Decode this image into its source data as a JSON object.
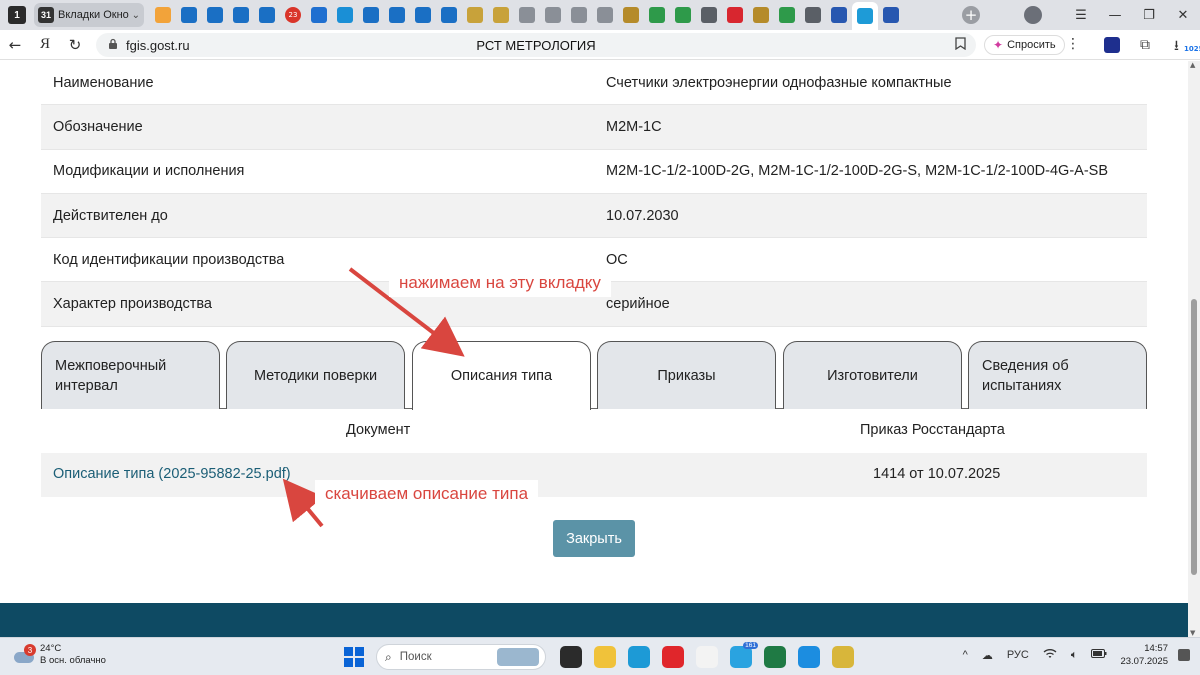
{
  "browser": {
    "tab_counter": "1",
    "group_tab": {
      "icon_text": "31",
      "label": "Вкладки Окно 1"
    },
    "pinned_tabs": [
      {
        "icon": "mail-icon",
        "color": "#f2a33a"
      },
      {
        "icon": "rst-icon",
        "color": "#1a6fc4"
      },
      {
        "icon": "rst-icon",
        "color": "#1a6fc4"
      },
      {
        "icon": "rst-icon",
        "color": "#1a6fc4"
      },
      {
        "icon": "rst-icon",
        "color": "#1a6fc4"
      },
      {
        "icon": "calendar-icon",
        "color": "#d9352a",
        "text": "23"
      },
      {
        "icon": "app-icon",
        "color": "#1f6fd0"
      },
      {
        "icon": "shield-icon",
        "color": "#1a8fd6"
      },
      {
        "icon": "rst-icon",
        "color": "#1a6fc4"
      },
      {
        "icon": "rst-icon",
        "color": "#1a6fc4"
      },
      {
        "icon": "rst-icon",
        "color": "#1a6fc4"
      },
      {
        "icon": "rst-icon",
        "color": "#1a6fc4"
      },
      {
        "icon": "emblem-icon",
        "color": "#c8a23a"
      },
      {
        "icon": "emblem-icon",
        "color": "#c8a23a"
      },
      {
        "icon": "document-icon",
        "color": "#8a8f97"
      },
      {
        "icon": "document-icon",
        "color": "#8a8f97"
      },
      {
        "icon": "document-icon",
        "color": "#8a8f97"
      },
      {
        "icon": "document-icon",
        "color": "#8a8f97"
      },
      {
        "icon": "emblem-icon",
        "color": "#b58b2a"
      },
      {
        "icon": "plus-icon",
        "color": "#2e9a4a"
      },
      {
        "icon": "plus-icon",
        "color": "#2e9a4a"
      },
      {
        "icon": "rst-icon",
        "color": "#5a5f66"
      },
      {
        "icon": "diamond-icon",
        "color": "#d8262f"
      },
      {
        "icon": "emblem-icon",
        "color": "#b58b2a"
      },
      {
        "icon": "plus-icon",
        "color": "#2e9a4a"
      },
      {
        "icon": "rst-icon",
        "color": "#5a5f66"
      },
      {
        "icon": "app-icon",
        "color": "#2757b0"
      },
      {
        "icon": "app-icon",
        "color": "#1e9bd7",
        "active": true
      },
      {
        "icon": "app-icon",
        "color": "#2757b0"
      }
    ],
    "window_controls": [
      "☰",
      "—",
      "❐",
      "✕"
    ],
    "address_bar": {
      "back_icon": "←",
      "yandex_icon": "Я",
      "reload_icon": "↻",
      "lock_icon": "🔒",
      "url": "fgis.gost.ru",
      "page_title": "РСТ МЕТРОЛОГИЯ",
      "bookmark_icon": "☐",
      "ask_label": "Спросить",
      "more_icon": "⋮",
      "downloads_badge": "1025"
    }
  },
  "page": {
    "info_rows": [
      {
        "key": "Наименование",
        "value": "Счетчики электроэнергии однофазные компактные"
      },
      {
        "key": "Обозначение",
        "value": "M2M-1C"
      },
      {
        "key": "Модификации и исполнения",
        "value": "M2M-1C-1/2-100D-2G, M2M-1C-1/2-100D-2G-S, M2M-1C-1/2-100D-4G-A-SB"
      },
      {
        "key": "Действителен до",
        "value": "10.07.2030"
      },
      {
        "key": "Код идентификации производства",
        "value": "ОС"
      },
      {
        "key": "Характер производства",
        "value": "серийное"
      }
    ],
    "tabs": [
      {
        "label": "Межповерочный интервал",
        "active": false
      },
      {
        "label": "Методики поверки",
        "active": false
      },
      {
        "label": "Описания типа",
        "active": true
      },
      {
        "label": "Приказы",
        "active": false
      },
      {
        "label": "Изготовители",
        "active": false
      },
      {
        "label": "Сведения об испытаниях",
        "active": false
      }
    ],
    "doc_table": {
      "headers": [
        "Документ",
        "Приказ Росстандарта"
      ],
      "rows": [
        {
          "document": "Описание типа (2025-95882-25.pdf)",
          "order": "1414 от 10.07.2025"
        }
      ]
    },
    "close_button": "Закрыть",
    "annotations": {
      "tab_hint": "нажимаем на эту вкладку",
      "download_hint": "скачиваем описание типа",
      "color": "#d9463f"
    },
    "colors": {
      "link": "#1b5e76",
      "button": "#5b93a7",
      "footer": "#0e4a63"
    }
  },
  "taskbar": {
    "weather": {
      "badge": "3",
      "temp": "24°C",
      "desc": "В осн. облачно"
    },
    "search_placeholder": "Поиск",
    "apps": [
      {
        "icon": "terminal-icon",
        "color": "#2b2b2b"
      },
      {
        "icon": "folder-icon",
        "color": "#f0c23a"
      },
      {
        "icon": "edge-icon",
        "color": "#1d9ad6"
      },
      {
        "icon": "opera-icon",
        "color": "#e0262b"
      },
      {
        "icon": "yandex-browser-icon",
        "color": "#f3f3f3"
      },
      {
        "icon": "telegram-icon",
        "color": "#2aa3e0",
        "badge": "161"
      },
      {
        "icon": "excel-icon",
        "color": "#1f7a44"
      },
      {
        "icon": "ie-icon",
        "color": "#1c8de0"
      },
      {
        "icon": "notes-icon",
        "color": "#d8b63a"
      }
    ],
    "tray": {
      "chevron": "^",
      "lang": "РУС",
      "time": "14:57",
      "date": "23.07.2025"
    }
  }
}
